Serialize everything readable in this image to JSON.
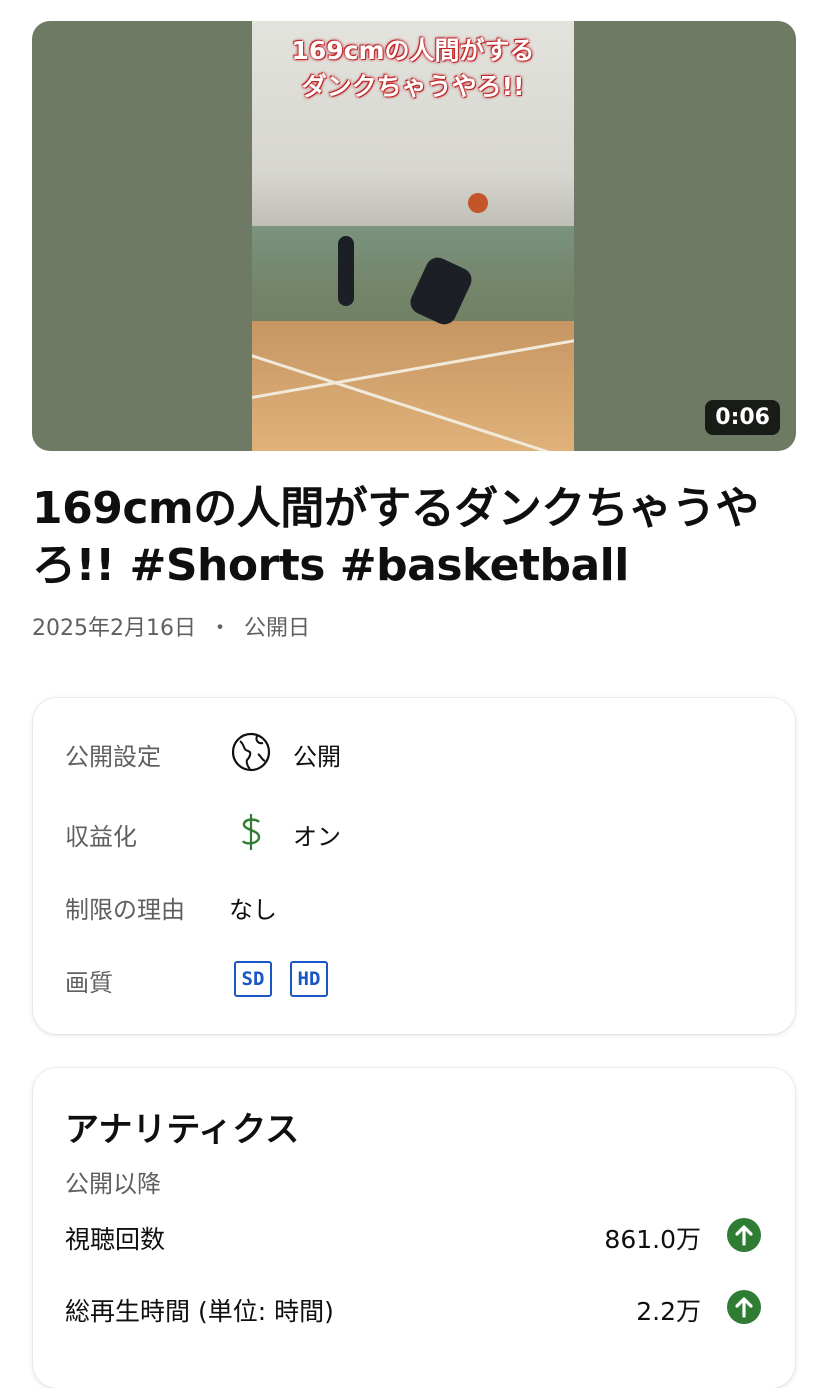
{
  "video": {
    "overlay_line1": "169cmの人間がする",
    "overlay_line2": "ダンクちゃうやろ!!",
    "duration": "0:06"
  },
  "title": "169cmの人間がするダンクちゃうやろ!! #Shorts #basketball",
  "meta": {
    "date": "2025年2月16日",
    "separator": "・",
    "status": "公開日"
  },
  "details": {
    "visibility": {
      "label": "公開設定",
      "value": "公開",
      "icon": "globe-icon"
    },
    "monetization": {
      "label": "収益化",
      "value": "オン",
      "icon": "dollar-icon"
    },
    "restrictions": {
      "label": "制限の理由",
      "value": "なし"
    },
    "quality": {
      "label": "画質",
      "badges": [
        "SD",
        "HD"
      ],
      "icon_color": "#1a56c4"
    }
  },
  "analytics": {
    "title": "アナリティクス",
    "subtitle": "公開以降",
    "rows": [
      {
        "label": "視聴回数",
        "value": "861.0万",
        "trend": "up"
      },
      {
        "label": "総再生時間 (単位: 時間)",
        "value": "2.2万",
        "trend": "up"
      }
    ],
    "trend_color": "#2e7d32"
  }
}
